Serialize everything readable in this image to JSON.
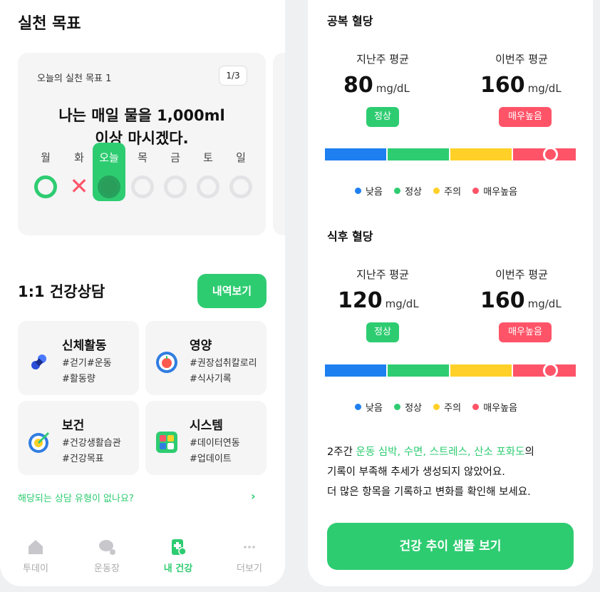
{
  "goal": {
    "title": "실천 목표",
    "card_label": "오늘의 실천 목표 1",
    "page": "1/3",
    "line1": "나는 매일 물을 1,000ml",
    "line2": "이상 마시겠다.",
    "days": [
      "월",
      "화",
      "오늘",
      "목",
      "금",
      "토",
      "일"
    ]
  },
  "consult": {
    "title": "1:1 건강상담",
    "history_button": "내역보기",
    "categories": [
      {
        "name": "신체활동",
        "tag1": "#걷기#운동",
        "tag2": "#활동량"
      },
      {
        "name": "영양",
        "tag1": "#권장섭취칼로리",
        "tag2": "#식사기록"
      },
      {
        "name": "보건",
        "tag1": "#건강생활습관",
        "tag2": "#건강목표"
      },
      {
        "name": "시스템",
        "tag1": "#데이터연동",
        "tag2": "#업데이트"
      }
    ],
    "no_match": "해당되는 상담 유형이 없나요?",
    "no_match_arrow": "›"
  },
  "tabs": [
    {
      "label": "투데이",
      "icon": "home-icon"
    },
    {
      "label": "운동장",
      "icon": "chat-icon"
    },
    {
      "label": "내 건강",
      "icon": "health-icon"
    },
    {
      "label": "더보기",
      "icon": "more-icon"
    }
  ],
  "fasting": {
    "title": "공복 혈당",
    "last_label": "지난주 평균",
    "this_label": "이번주 평균",
    "last_value": "80",
    "this_value": "160",
    "unit": "mg/dL",
    "last_status": "정상",
    "this_status": "매우높음"
  },
  "postmeal": {
    "title": "식후 혈당",
    "last_label": "지난주 평균",
    "this_label": "이번주 평균",
    "last_value": "120",
    "this_value": "160",
    "unit": "mg/dL",
    "last_status": "정상",
    "this_status": "매우높음"
  },
  "legend": [
    "낮음",
    "정상",
    "주의",
    "매우높음"
  ],
  "colors": {
    "low": "#1e7ff0",
    "normal": "#2ecc71",
    "caution": "#ffd028",
    "very_high": "#ff5468",
    "accent": "#2ecc71"
  },
  "note": {
    "prefix": "2주간 ",
    "highlight": "운동 심박, 수면, 스트레스, 산소 포화도",
    "suffix": "의",
    "line2": "기록이 부족해 추세가 생성되지 않았어요.",
    "line3": "더 많은 항목을 기록하고 변화를 확인해 보세요."
  },
  "sample_button": "건강 추이 샘플 보기"
}
